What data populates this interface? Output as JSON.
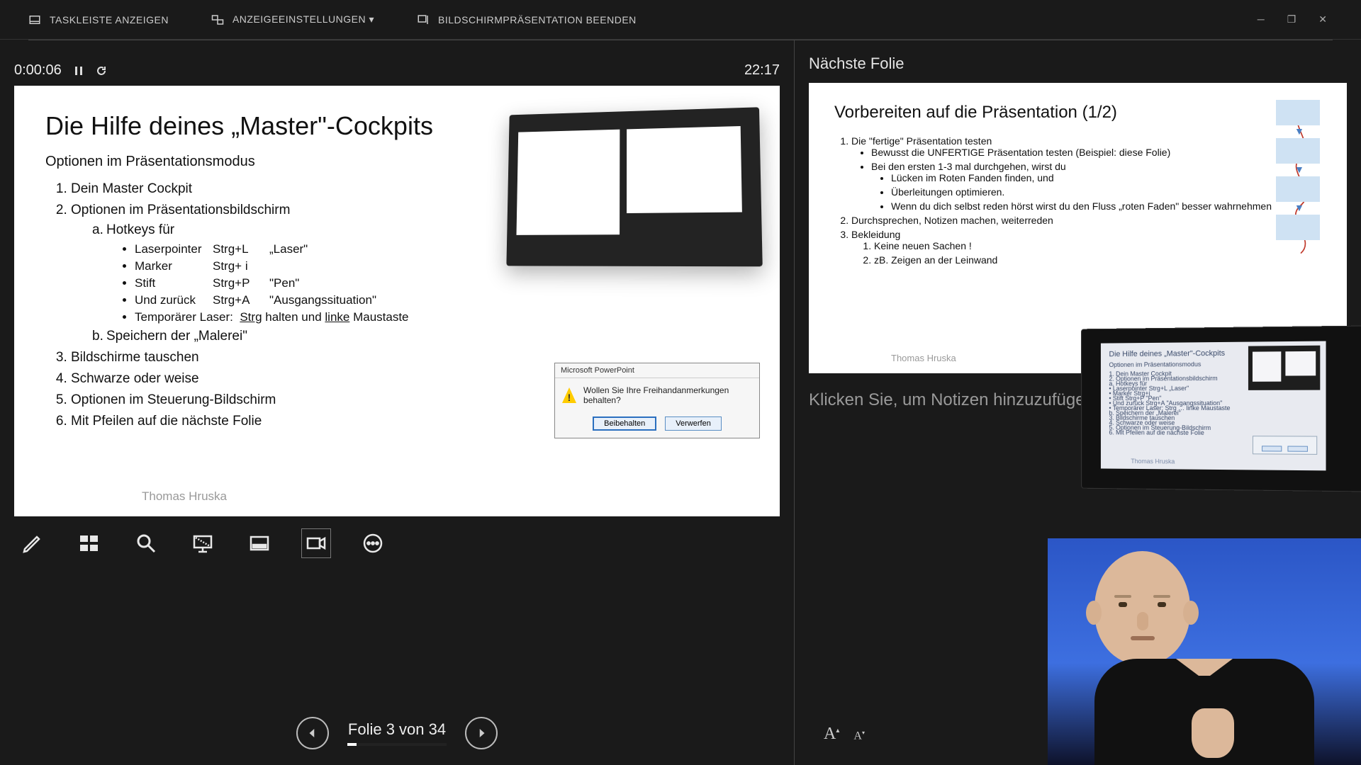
{
  "top": {
    "taskbar": "TASKLEISTE ANZEIGEN",
    "display": "ANZEIGEEINSTELLUNGEN ▾",
    "end": "BILDSCHIRMPRÄSENTATION BEENDEN"
  },
  "timer": {
    "elapsed": "0:00:06",
    "clock": "22:17"
  },
  "slide": {
    "title": "Die Hilfe deines „Master\"-Cockpits",
    "subtitle": "Optionen im Präsentationsmodus",
    "items": {
      "i1": "Dein Master Cockpit",
      "i2": "Optionen im Präsentationsbildschirm",
      "i2a": "Hotkeys für",
      "hot": [
        {
          "k": "Laserpointer",
          "s": "Strg+L",
          "d": "„Laser\""
        },
        {
          "k": "Marker",
          "s": "Strg+ i",
          "d": ""
        },
        {
          "k": "Stift",
          "s": "Strg+P",
          "d": "\"Pen\""
        },
        {
          "k": "Und zurück",
          "s": "Strg+A",
          "d": "\"Ausgangssituation\""
        }
      ],
      "hot_temp": "Temporärer Laser:  Strg halten und linke Maustaste",
      "i2b": "Speichern der „Malerei\"",
      "i3": "Bildschirme tauschen",
      "i4": "Schwarze oder weise",
      "i5": "Optionen im Steuerung-Bildschirm",
      "i6": "Mit Pfeilen auf die nächste Folie"
    },
    "author": "Thomas Hruska",
    "dialog": {
      "title": "Microsoft PowerPoint",
      "msg": "Wollen Sie Ihre Freihandanmerkungen behalten?",
      "keep": "Beibehalten",
      "discard": "Verwerfen"
    }
  },
  "nav": {
    "counter": "Folie 3 von 34"
  },
  "next": {
    "heading": "Nächste Folie",
    "title": "Vorbereiten auf die Präsentation (1/2)",
    "p1": "Die \"fertige\" Präsentation testen",
    "p1a": "Bewusst die UNFERTIGE Präsentation testen (Beispiel: diese Folie)",
    "p1b": "Bei den ersten 1-3 mal durchgehen, wirst du",
    "p1b1": "Lücken im Roten Fanden finden, und",
    "p1b2": "Überleitungen optimieren.",
    "p1b3": "Wenn du dich selbst reden hörst wirst du den Fluss „roten Faden\" besser wahrnehmen",
    "p2": "Durchsprechen, Notizen machen, weiterreden",
    "p3": "Bekleidung",
    "p3a": "Keine neuen Sachen !",
    "p3b": "zB. Zeigen an der Leinwand",
    "author": "Thomas Hruska"
  },
  "notes": {
    "placeholder": "Klicken Sie, um Notizen hinzuzufüge"
  },
  "reflection": {
    "title": "Die Hilfe deines „Master\"-Cockpits",
    "sub": "Optionen im Präsentationsmodus",
    "lines": [
      "1. Dein Master Cockpit",
      "2. Optionen im Präsentationsbildschirm",
      "   a. Hotkeys für",
      "      • Laserpointer  Strg+L  „Laser\"",
      "      • Marker  Strg+i",
      "      • Stift  Strg+P  \"Pen\"",
      "      • Und zurück  Strg+A  \"Ausgangssituation\"",
      "      • Temporärer Laser: Strg … linke Maustaste",
      "   b. Speichern der „Malerei\"",
      "3. Bildschirme tauschen",
      "4. Schwarze oder weise",
      "5. Optionen im Steuerung-Bildschirm",
      "6. Mit Pfeilen auf die nächste Folie"
    ],
    "author": "Thomas Hruska"
  }
}
